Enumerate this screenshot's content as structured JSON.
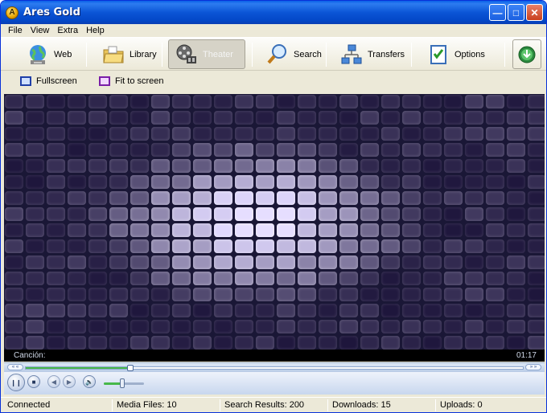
{
  "window": {
    "title": "Ares Gold",
    "app_icon_letter": "A"
  },
  "title_buttons": {
    "minimize": "—",
    "maximize": "□",
    "close": "✕"
  },
  "menu": [
    "File",
    "View",
    "Extra",
    "Help"
  ],
  "toolbar": [
    {
      "label": "Web",
      "icon": "globe-icon",
      "active": false
    },
    {
      "label": "Library",
      "icon": "folder-icon",
      "active": false
    },
    {
      "label": "Theater",
      "icon": "film-reel-icon",
      "active": true
    },
    {
      "label": "Search",
      "icon": "magnifier-icon",
      "active": false
    },
    {
      "label": "Transfers",
      "icon": "network-icon",
      "active": false
    },
    {
      "label": "Options",
      "icon": "checklist-icon",
      "active": false
    }
  ],
  "toolbar_right_icon": "download-icon",
  "subbar": {
    "fullscreen": "Fullscreen",
    "fit": "Fit to screen"
  },
  "player": {
    "caption_label": "Canción:",
    "time": "01:17",
    "seek_progress": 0.21,
    "volume_level": 0.45,
    "seek_left_glyph": "« «",
    "seek_right_glyph": "» »"
  },
  "colors": {
    "title_blue": "#0b55d6",
    "video_bg": "#1a1736",
    "seek_green": "#47b84a"
  },
  "status": {
    "connection": "Connected",
    "media_files": "Media Files: 10",
    "search_results": "Search Results: 200",
    "downloads": "Downloads: 15",
    "uploads": "Uploads: 0"
  }
}
